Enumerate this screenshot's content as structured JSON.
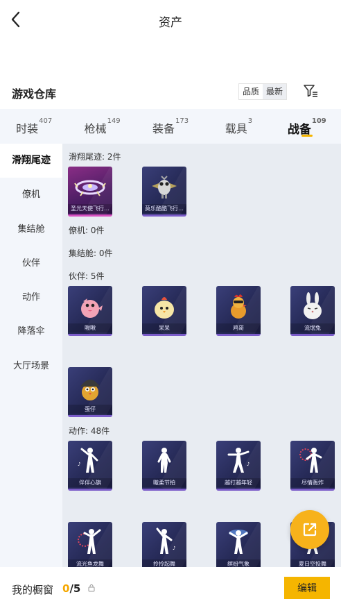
{
  "header": {
    "title": "资产",
    "back_icon": "chevron-left-icon"
  },
  "warehouse": {
    "title": "游戏仓库",
    "sort": [
      {
        "label": "品质",
        "active": false
      },
      {
        "label": "最新",
        "active": true
      }
    ],
    "filter_icon": "filter-icon"
  },
  "tabs": [
    {
      "label": "时装",
      "count": "407",
      "active": false
    },
    {
      "label": "枪械",
      "count": "149",
      "active": false
    },
    {
      "label": "装备",
      "count": "173",
      "active": false
    },
    {
      "label": "载具",
      "count": "3",
      "active": false
    },
    {
      "label": "战备",
      "count": "109",
      "active": true
    }
  ],
  "sidebar": [
    {
      "label": "滑翔尾迹",
      "active": true
    },
    {
      "label": "僚机",
      "active": false
    },
    {
      "label": "集结舱",
      "active": false
    },
    {
      "label": "伙伴",
      "active": false
    },
    {
      "label": "动作",
      "active": false
    },
    {
      "label": "降落伞",
      "active": false
    },
    {
      "label": "大厅场景",
      "active": false
    }
  ],
  "sections": {
    "glide": {
      "heading": "滑翔尾迹: 2件",
      "items": [
        {
          "name": "圣光天使飞行…",
          "icon": "halo-glider-icon"
        },
        {
          "name": "莫乐酷酷飞行…",
          "icon": "robot-bird-glider-icon"
        }
      ]
    },
    "wingman": {
      "heading": "僚机: 0件"
    },
    "pod": {
      "heading": "集结舱: 0件"
    },
    "buddy": {
      "heading": "伙伴: 5件",
      "items": [
        {
          "name": "啾啾",
          "icon": "pink-bird-icon"
        },
        {
          "name": "呆呆",
          "icon": "yellow-chick-icon"
        },
        {
          "name": "鸡哥",
          "icon": "rooster-icon"
        },
        {
          "name": "流氓兔",
          "icon": "white-rabbit-icon"
        },
        {
          "name": "蛋仔",
          "icon": "helmet-chick-icon"
        }
      ]
    },
    "emote": {
      "heading": "动作: 48件",
      "items": [
        {
          "name": "伴伴心旗",
          "icon": "dance-pose-icon"
        },
        {
          "name": "嗷柔节拍",
          "icon": "dance-pose-icon"
        },
        {
          "name": "越打越年轻",
          "icon": "dance-pose-icon"
        },
        {
          "name": "尽情轰炸",
          "icon": "dance-pose-icon"
        },
        {
          "name": "流光鱼龙舞",
          "icon": "dance-pose-icon"
        },
        {
          "name": "拎拎起舞",
          "icon": "dance-pose-icon"
        },
        {
          "name": "缤纷气象",
          "icon": "dance-pose-icon"
        },
        {
          "name": "夏日空投舞",
          "icon": "dance-pose-icon"
        }
      ]
    }
  },
  "float_button_icon": "external-share-icon",
  "showcase": {
    "label": "我的橱窗",
    "current": "0",
    "total": "/5",
    "lock_icon": "lock-icon",
    "edit_label": "编辑"
  },
  "colors": {
    "accent": "#f5b500",
    "tab_bg": "#f3f6fb",
    "content_bg": "#e8ecf2",
    "card_dark": "#262a57",
    "card_pink": "#8a2d86"
  }
}
